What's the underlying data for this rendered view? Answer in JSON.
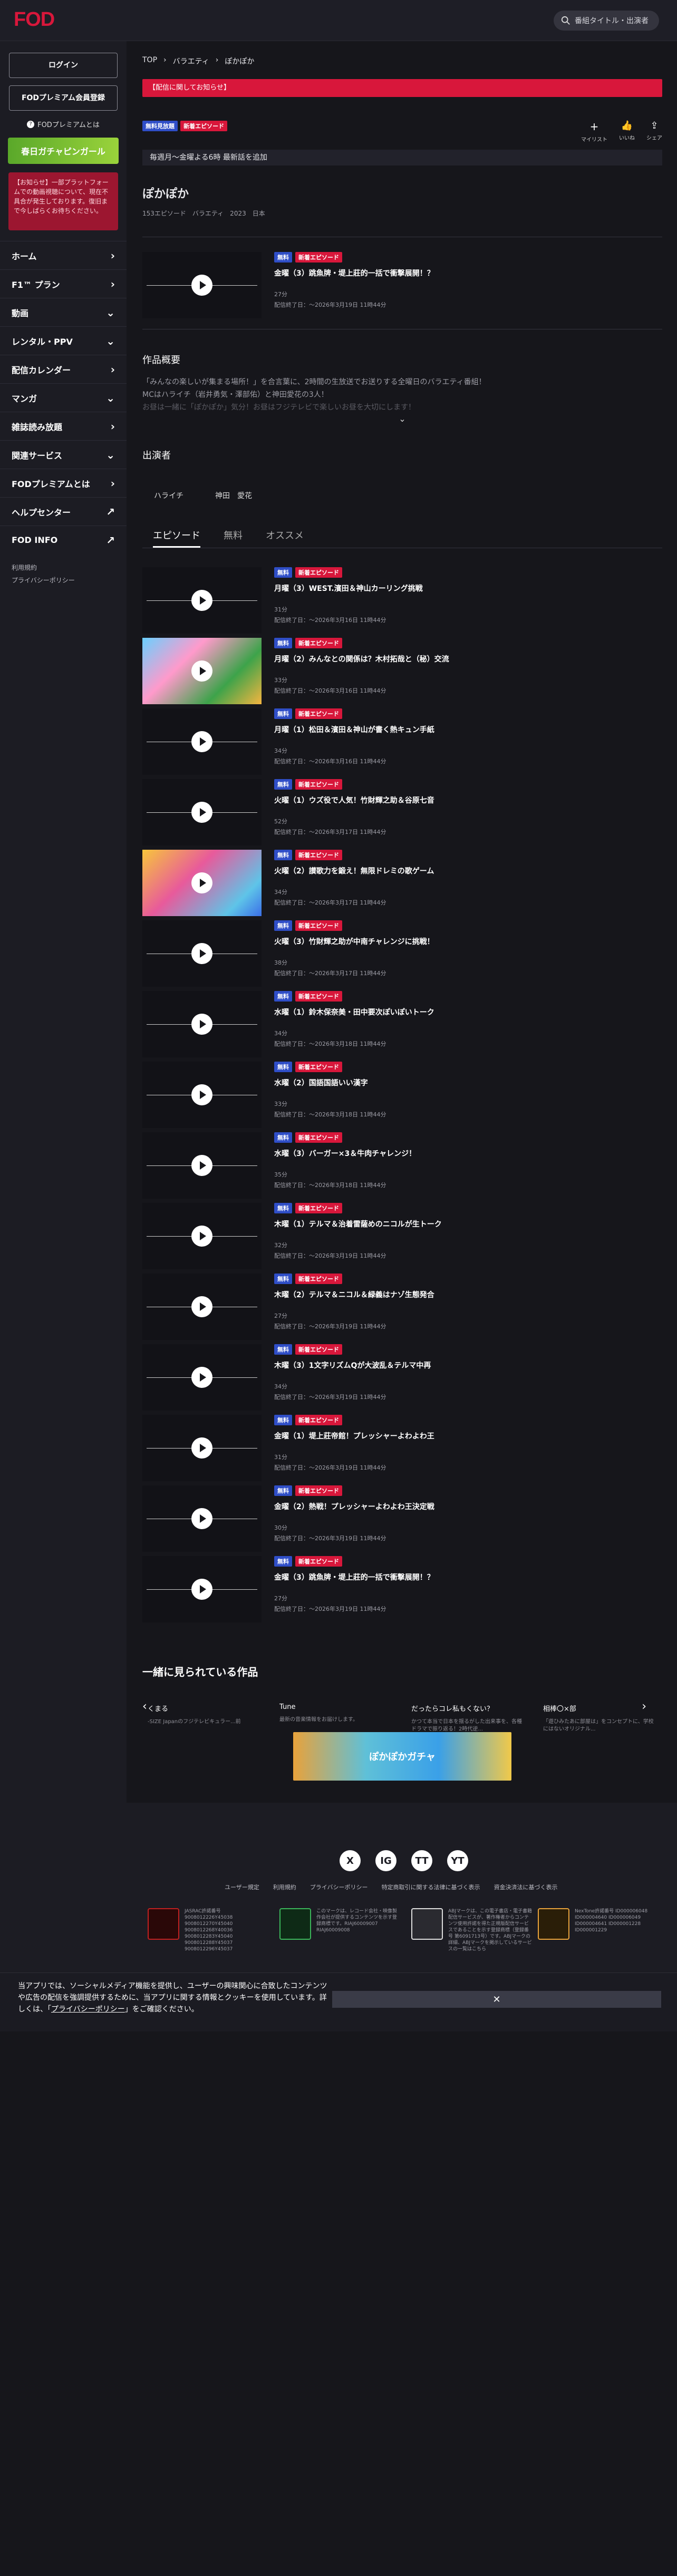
{
  "header": {
    "logo": "FOD",
    "search_placeholder": "番組タイトル・出演者"
  },
  "sidebar": {
    "login": "ログイン",
    "register": "FODプレミアム会員登録",
    "about": "FODプレミアムとは",
    "banner": "春日ガチャピンガール",
    "alert": "【お知らせ】一部プラットフォームでの動画視聴について、現在不具合が発生しております。復旧まで今しばらくお待ちください。",
    "nav": [
      {
        "label": "ホーム",
        "icon": "chevron-right"
      },
      {
        "label": "F1™ プラン",
        "icon": "chevron-right"
      },
      {
        "label": "動画",
        "icon": "chevron-down"
      },
      {
        "label": "レンタル・PPV",
        "icon": "chevron-down"
      },
      {
        "label": "配信カレンダー",
        "icon": "chevron-right"
      },
      {
        "label": "マンガ",
        "icon": "chevron-down"
      },
      {
        "label": "雑誌読み放題",
        "icon": "chevron-right"
      },
      {
        "label": "関連サービス",
        "icon": "chevron-down"
      },
      {
        "label": "FODプレミアムとは",
        "icon": "chevron-right"
      },
      {
        "label": "ヘルプセンター",
        "icon": "external-link"
      },
      {
        "label": "FOD INFO",
        "icon": "external-link"
      }
    ],
    "sub": [
      "利用規約",
      "プライバシーポリシー"
    ]
  },
  "breadcrumb": [
    "TOP",
    "バラエティ",
    "ぽかぽか"
  ],
  "notice": "【配信に関してお知らせ】",
  "tags": {
    "free": "無料見放題",
    "new": "新着エピソード"
  },
  "actions": {
    "mylist": "マイリスト",
    "like": "いいね",
    "share": "シェア"
  },
  "schedule": "毎週月〜金曜よる6時 最新話を追加",
  "program": {
    "title": "ぽかぽか",
    "meta": "153エピソード　バラエティ　2023　日本"
  },
  "featured": {
    "free": "無料",
    "new": "新着エピソード",
    "title": "金曜（3）跳魚牌・堤上莊的一括で衝撃展開！？",
    "dur": "27分",
    "date": "配信終了日：～2026年3月19日 11時44分"
  },
  "synopsis": {
    "heading": "作品概要",
    "text": "「みんなの楽しいが集まる場所！」を合言葉に、2時間の生放送でお送りする全曜日のバラエティ番組！",
    "text2": "MCはハライチ（岩井勇気・澤部佑）と神田愛花の3人！",
    "text3": "お昼は一緒に「ぽかぽか」気分！お昼はフジテレビで楽しいお昼を大切にします！"
  },
  "cast": {
    "heading": "出演者",
    "people": [
      "ハライチ",
      "神田　愛花"
    ]
  },
  "tabs": [
    "エピソード",
    "無料",
    "オススメ"
  ],
  "episodes": [
    {
      "title": "月曜（3）WEST.濱田＆神山カーリング挑戦",
      "dur": "31分",
      "date": "配信終了日：～2026年3月16日 11時44分",
      "img": false
    },
    {
      "title": "月曜（2）みんなとの関係は？木村拓哉と（秘）交流",
      "dur": "33分",
      "date": "配信終了日：～2026年3月16日 11時44分",
      "img": true
    },
    {
      "title": "月曜（1）松田＆濱田＆神山が書く熱キュン手紙",
      "dur": "34分",
      "date": "配信終了日：～2026年3月16日 11時44分",
      "img": false
    },
    {
      "title": "火曜（1）ウズ役で人気！竹財輝之助＆谷原七音",
      "dur": "52分",
      "date": "配信終了日：～2026年3月17日 11時44分",
      "img": false
    },
    {
      "title": "火曜（2）讃歌力を鍛え！無限ドレミの歌ゲーム",
      "dur": "34分",
      "date": "配信終了日：～2026年3月17日 11時44分",
      "img": true
    },
    {
      "title": "火曜（3）竹財輝之助が中南チャレンジに挑戦！",
      "dur": "38分",
      "date": "配信終了日：～2026年3月17日 11時44分",
      "img": false
    },
    {
      "title": "水曜（1）鈴木保奈美・田中要次ぽいぽいトーク",
      "dur": "34分",
      "date": "配信終了日：～2026年3月18日 11時44分",
      "img": false
    },
    {
      "title": "水曜（2）国語国語いい漢字",
      "dur": "33分",
      "date": "配信終了日：～2026年3月18日 11時44分",
      "img": false
    },
    {
      "title": "水曜（3）バーガー×3＆牛肉チャレンジ！",
      "dur": "35分",
      "date": "配信終了日：～2026年3月18日 11時44分",
      "img": false
    },
    {
      "title": "木曜（1）テルマ＆治着雷薩めのニコルが生トーク",
      "dur": "32分",
      "date": "配信終了日：～2026年3月19日 11時44分",
      "img": false
    },
    {
      "title": "木曜（2）テルマ＆ニコル＆緑義はナゾ生態発合",
      "dur": "27分",
      "date": "配信終了日：～2026年3月19日 11時44分",
      "img": false
    },
    {
      "title": "木曜（3）1文字リズムQが大波乱＆テルマ中再",
      "dur": "34分",
      "date": "配信終了日：～2026年3月19日 11時44分",
      "img": false
    },
    {
      "title": "金曜（1）堤上莊帝館！プレッシャーよわよわ王",
      "dur": "31分",
      "date": "配信終了日：～2026年3月19日 11時44分",
      "img": false
    },
    {
      "title": "金曜（2）熱戦！プレッシャーよわよわ王決定戦",
      "dur": "30分",
      "date": "配信終了日：～2026年3月19日 11時44分",
      "img": false
    },
    {
      "title": "金曜（3）跳魚牌・堤上莊的一括で衝撃展開！？",
      "dur": "27分",
      "date": "配信終了日：～2026年3月19日 11時44分",
      "img": false
    }
  ],
  "recommend": {
    "heading": "一緒に見られている作品",
    "items": [
      {
        "title": "くまる",
        "sub": "-SIZE Japanのフジテレビキュラー...前"
      },
      {
        "title": "Tune",
        "sub": "最新の音楽情報をお届けします。"
      },
      {
        "title": "だったらコレ私もくない？",
        "sub": "かつて本当で日本を揺るがした出来事を、各種ドラマで振り返る！2時代逆..."
      },
      {
        "title": "相棒〇×部",
        "sub": "「遊ひみたあに部屋は」をコンセプトに、学校にはないオリジナル..."
      }
    ]
  },
  "banner_bottom": "ぽかぽかガチャ",
  "footer": {
    "social": [
      "X",
      "IG",
      "TT",
      "YT"
    ],
    "links": [
      "ユーザー規定",
      "利用規約",
      "プライバシーポリシー",
      "特定商取引に関する法律に基づく表示",
      "資金決済法に基づく表示"
    ],
    "licenses": [
      {
        "label": "JASRAC許諾番号 9008012226Y45038 9008012270Y45040 9008012268Y40036 9008012283Y45040 9008012288Y45037 9008012296Y45037"
      },
      {
        "label": "このマークは、レコード会社・映像製作会社が提供するコンテンツを示す登録商標です。RIAJ60009007 RIAJ60009008"
      },
      {
        "label": "ABJマークは、この電子書店・電子書籍配信サービスが、著作権者からコンテンツ使用許諾を得た正規版配信サービスであることを示す登録商標（登録番号 第6091713号）です。ABJマークの詳細、ABJマークを掲示しているサービスの一覧はこちら"
      },
      {
        "label": "NexTone許諾番号 ID000006048 ID000004640 ID000006049 ID000004641 ID000001228 ID000001229"
      }
    ]
  },
  "cookie": {
    "text_a": "当アプリでは、ソーシャルメディア機能を提供し、ユーザーの興味関心に合致したコンテンツや広告の配信を強調提供するために、",
    "text_b": "当アプリに関する情報とクッキーを使用しています。詳しくは、「",
    "link": "プライバシーポリシー",
    "text_c": "」をご確認ください。",
    "close": "✕"
  }
}
